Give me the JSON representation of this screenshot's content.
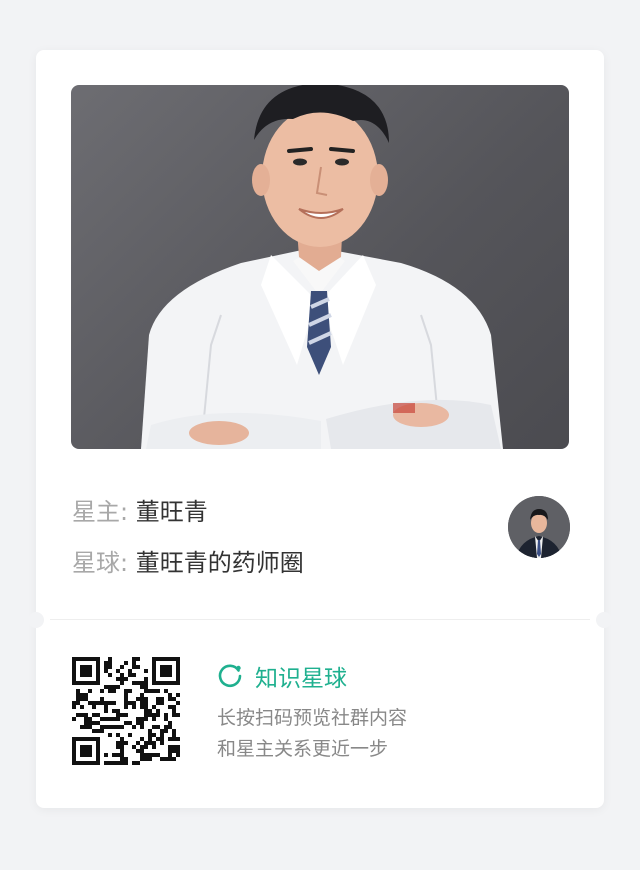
{
  "owner": {
    "label": "星主:",
    "name": "董旺青"
  },
  "planet": {
    "label": "星球:",
    "name": "董旺青的药师圈"
  },
  "brand": {
    "name": "知识星球",
    "color": "#1fb08f",
    "icon": "planet-logo-icon"
  },
  "description": {
    "line1": "长按扫码预览社群内容",
    "line2": "和星主关系更近一步"
  },
  "photo": {
    "icon": "doctor-portrait"
  },
  "avatar": {
    "icon": "owner-avatar"
  },
  "qr": {
    "icon": "qr-code"
  }
}
